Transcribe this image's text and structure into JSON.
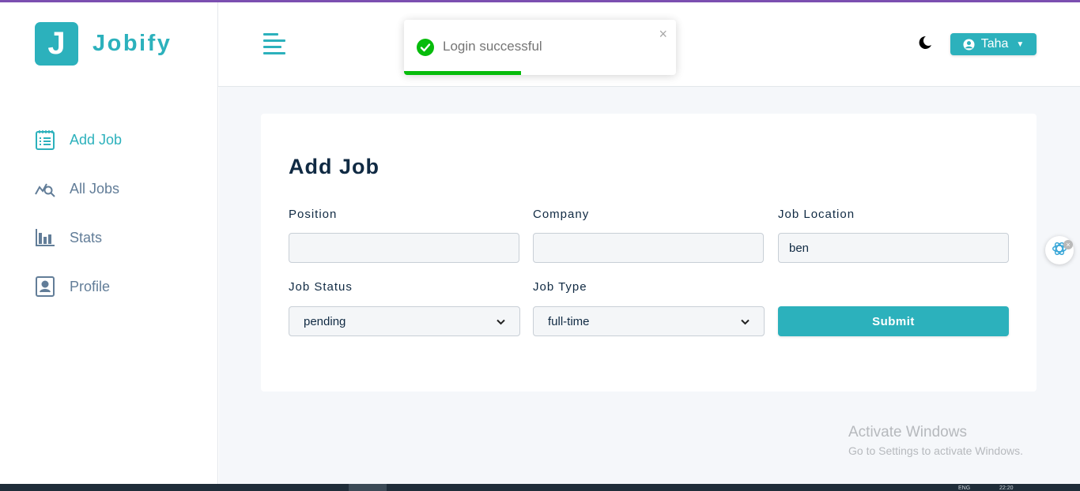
{
  "app": {
    "name": "Jobify",
    "logo_letter": "J"
  },
  "colors": {
    "primary": "#2cb1bc",
    "toast_success": "#07bc0c",
    "text": "#102a43",
    "muted": "#627d98"
  },
  "sidebar": {
    "items": [
      {
        "label": "Add Job",
        "icon": "add-job-icon",
        "active": true
      },
      {
        "label": "All Jobs",
        "icon": "all-jobs-icon",
        "active": false
      },
      {
        "label": "Stats",
        "icon": "stats-icon",
        "active": false
      },
      {
        "label": "Profile",
        "icon": "profile-icon",
        "active": false
      }
    ]
  },
  "header": {
    "user_name": "Taha",
    "theme_icon": "moon-icon"
  },
  "toast": {
    "message": "Login successful",
    "type": "success",
    "close": "×",
    "progress": 0.43
  },
  "form": {
    "title": "Add Job",
    "position": {
      "label": "Position",
      "value": ""
    },
    "company": {
      "label": "Company",
      "value": ""
    },
    "job_location": {
      "label": "Job Location",
      "value": "ben"
    },
    "job_status": {
      "label": "Job Status",
      "value": "pending"
    },
    "job_type": {
      "label": "Job Type",
      "value": "full-time"
    },
    "submit_label": "Submit"
  },
  "watermark": {
    "title": "Activate Windows",
    "subtitle": "Go to Settings to activate Windows."
  },
  "taskbar": {
    "lang": "ENG",
    "time": "22:20"
  }
}
